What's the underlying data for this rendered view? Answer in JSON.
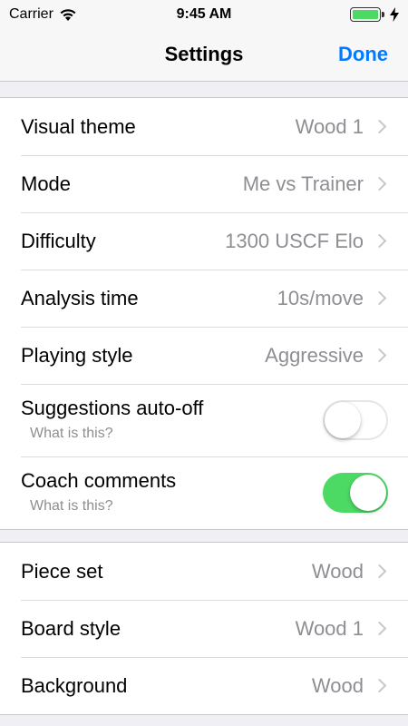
{
  "status_bar": {
    "carrier": "Carrier",
    "time": "9:45 AM",
    "battery_level": 1.0,
    "icons": [
      "wifi-icon",
      "battery-icon",
      "charging-bolt-icon"
    ]
  },
  "nav": {
    "title": "Settings",
    "done_label": "Done"
  },
  "colors": {
    "accent": "#007aff",
    "toggle_on": "#4cd964",
    "secondary_text": "#8e8e93",
    "background": "#efeff4"
  },
  "group1": [
    {
      "label": "Visual theme",
      "value": "Wood 1"
    },
    {
      "label": "Mode",
      "value": "Me vs Trainer"
    },
    {
      "label": "Difficulty",
      "value": "1300 USCF Elo"
    },
    {
      "label": "Analysis time",
      "value": "10s/move"
    },
    {
      "label": "Playing style",
      "value": "Aggressive"
    }
  ],
  "toggles": [
    {
      "label": "Suggestions auto-off",
      "sub": "What is this?",
      "on": false
    },
    {
      "label": "Coach comments",
      "sub": "What is this?",
      "on": true
    }
  ],
  "group2": [
    {
      "label": "Piece set",
      "value": "Wood"
    },
    {
      "label": "Board style",
      "value": "Wood 1"
    },
    {
      "label": "Background",
      "value": "Wood"
    }
  ]
}
